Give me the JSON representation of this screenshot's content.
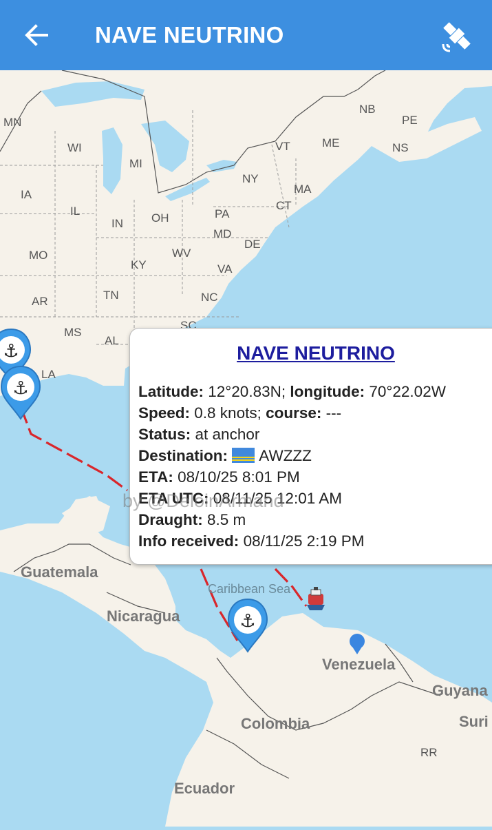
{
  "header": {
    "title": "NAVE NEUTRINO",
    "back_icon": "arrow-left-icon",
    "right_icon": "satellite-icon",
    "bar_color": "#3d8fe0"
  },
  "map": {
    "state_labels": [
      "MN",
      "WI",
      "MI",
      "IA",
      "IL",
      "IN",
      "OH",
      "MO",
      "KY",
      "WV",
      "AR",
      "TN",
      "NC",
      "MS",
      "AL",
      "LA",
      "SC",
      "NB",
      "PE",
      "NS",
      "ME",
      "VT",
      "NY",
      "MA",
      "CT",
      "PA",
      "MD",
      "DE",
      "VA",
      "RR"
    ],
    "country_labels": [
      "Guatemala",
      "Nicaragua",
      "Venezuela",
      "Colombia",
      "Guyana",
      "Suri",
      "Ecuador"
    ],
    "sea_label": "Caribbean Sea",
    "markers": [
      "anchor-marker-icon",
      "anchor-marker-icon",
      "anchor-marker-icon",
      "ship-icon",
      "location-dot-icon"
    ],
    "route_color": "#d9262b"
  },
  "popup": {
    "title": "NAVE NEUTRINO",
    "latitude_label": "Latitude:",
    "latitude_value": "12°20.83N;",
    "longitude_label": "longitude:",
    "longitude_value": "70°22.02W",
    "speed_label": "Speed:",
    "speed_value": "0.8 knots;",
    "course_label": "course:",
    "course_value": "---",
    "status_label": "Status:",
    "status_value": "at anchor",
    "destination_label": "Destination:",
    "destination_value": "AWZZZ",
    "destination_flag": "aruba-flag-icon",
    "eta_label": "ETA:",
    "eta_value": "08/10/25 8:01 PM",
    "eta_utc_label": "ETA UTC:",
    "eta_utc_value": "08/11/25 12:01 AM",
    "draught_label": "Draught:",
    "draught_value": "8.5 m",
    "info_label": "Info received:",
    "info_value": "08/11/25 2:19 PM"
  },
  "watermark": "by @DeloinArmand"
}
